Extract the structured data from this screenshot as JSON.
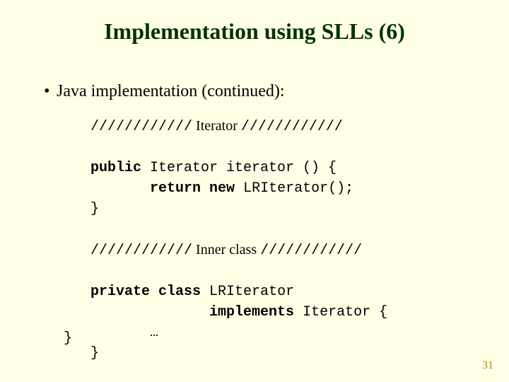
{
  "title": "Implementation using SLLs (6)",
  "bullet": "Java implementation (continued):",
  "code": {
    "sep1_left": "////////////",
    "sep1_label": " Iterator ",
    "sep1_right": "////////////",
    "m1_l1a": "public",
    "m1_l1b": " Iterator iterator () {",
    "m1_l2a": "       ",
    "m1_l2b": "return",
    "m1_l2c": " ",
    "m1_l2d": "new",
    "m1_l2e": " LRIterator();",
    "m1_l3": "}",
    "sep2_left": "////////////",
    "sep2_label": " Inner class ",
    "sep2_right": "////////////",
    "c1_l1a": "private",
    "c1_l1b": " ",
    "c1_l1c": "class",
    "c1_l1d": " LRIterator",
    "c1_l2a": "              ",
    "c1_l2b": "implements",
    "c1_l2c": " Iterator {",
    "c1_l3": "       …",
    "c1_l4": "}"
  },
  "closing_brace": "}",
  "page_number": "31"
}
